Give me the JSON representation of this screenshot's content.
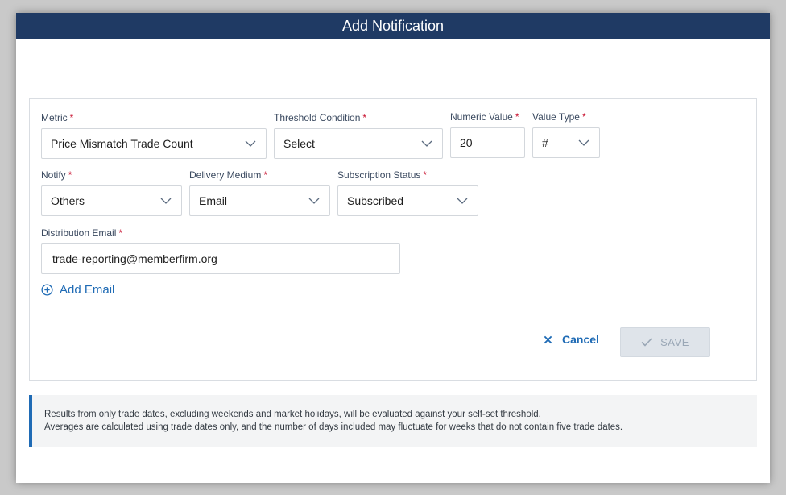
{
  "modal": {
    "title": "Add Notification"
  },
  "form": {
    "metric": {
      "label": "Metric",
      "required": "*",
      "value": "Price Mismatch Trade Count"
    },
    "threshold_condition": {
      "label": "Threshold Condition",
      "required": "*",
      "value": "Select"
    },
    "numeric_value": {
      "label": "Numeric Value",
      "required": "*",
      "value": "20"
    },
    "value_type": {
      "label": "Value Type",
      "required": "*",
      "value": "#"
    },
    "notify": {
      "label": "Notify",
      "required": "*",
      "value": "Others"
    },
    "delivery_medium": {
      "label": "Delivery Medium",
      "required": "*",
      "value": "Email"
    },
    "subscription_status": {
      "label": "Subscription Status",
      "required": "*",
      "value": "Subscribed"
    },
    "distribution_email": {
      "label": "Distribution Email",
      "required": "*",
      "value": "trade-reporting@memberfirm.org"
    },
    "add_email_label": "Add Email"
  },
  "actions": {
    "cancel_label": "Cancel",
    "save_label": "SAVE"
  },
  "info": {
    "line1": "Results from only trade dates, excluding weekends and market holidays, will be evaluated against your self-set threshold.",
    "line2": "Averages are calculated using trade dates only, and the number of days included may fluctuate for weeks that do not contain five trade dates."
  },
  "icons": {
    "chevron": "chevron-down-icon",
    "add": "plus-circle-icon",
    "close": "close-icon",
    "check": "check-icon"
  },
  "colors": {
    "header_bg": "#1f3a64",
    "accent": "#1f6bb5",
    "required": "#c8102e",
    "disabled_bg": "#dfe4ea"
  }
}
